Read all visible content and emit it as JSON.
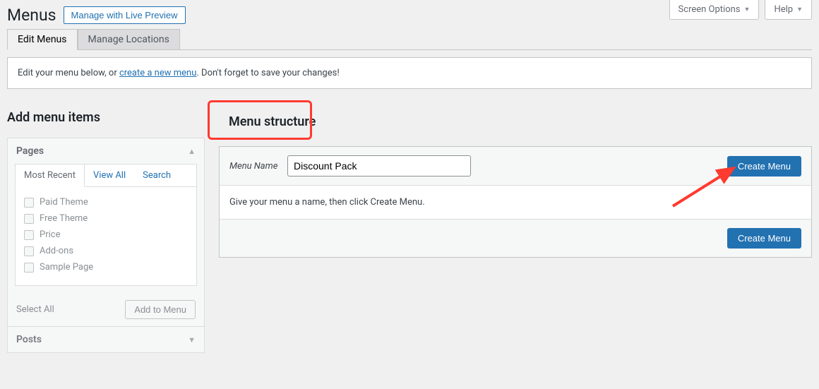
{
  "topTabs": {
    "screenOptions": "Screen Options",
    "help": "Help"
  },
  "header": {
    "title": "Menus",
    "livePreview": "Manage with Live Preview"
  },
  "navTabs": {
    "edit": "Edit Menus",
    "manage": "Manage Locations"
  },
  "notice": {
    "prefix": "Edit your menu below, or ",
    "link": "create a new menu",
    "suffix": ". Don't forget to save your changes!"
  },
  "leftCol": {
    "heading": "Add menu items",
    "pagesBox": {
      "title": "Pages",
      "subTabs": {
        "recent": "Most Recent",
        "viewAll": "View All",
        "search": "Search"
      },
      "items": [
        "Paid Theme",
        "Free Theme",
        "Price",
        "Add-ons",
        "Sample Page"
      ],
      "selectAll": "Select All",
      "addToMenu": "Add to Menu"
    },
    "postsBox": {
      "title": "Posts"
    }
  },
  "rightCol": {
    "heading": "Menu structure",
    "menuNameLabel": "Menu Name",
    "menuNameValue": "Discount Pack",
    "createMenu": "Create Menu",
    "instruction": "Give your menu a name, then click Create Menu."
  }
}
